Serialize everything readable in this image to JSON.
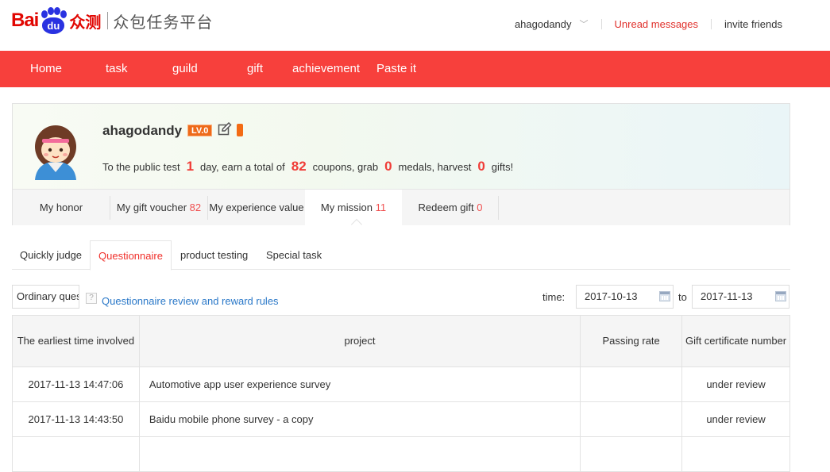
{
  "header": {
    "logo_bai": "Bai",
    "logo_du": "du",
    "logo_zc": "众测",
    "logo_subtitle": "众包任务平台",
    "username": "ahagodandy",
    "unread": "Unread messages",
    "invite": "invite friends"
  },
  "nav": [
    "Home",
    "task",
    "guild",
    "gift",
    "achievement",
    "Paste it"
  ],
  "profile": {
    "name": "ahagodandy",
    "level": "LV.0",
    "stats": {
      "prefix": "To the public test",
      "days": "1",
      "mid1": "day, earn a total of",
      "coupons": "82",
      "mid2": "coupons, grab",
      "medals": "0",
      "mid3": "medals, harvest",
      "gifts": "0",
      "suffix": "gifts!"
    },
    "tabs": [
      {
        "label": "My honor",
        "count": ""
      },
      {
        "label": "My gift voucher",
        "count": "82"
      },
      {
        "label": "My experience value",
        "count": ""
      },
      {
        "label": "My mission",
        "count": "11"
      },
      {
        "label": "Redeem gift",
        "count": "0"
      }
    ]
  },
  "subtabs": [
    "Quickly judge",
    "Questionnaire",
    "product testing",
    "Special task"
  ],
  "filter": {
    "select": "Ordinary questionnaire",
    "help": "?",
    "rules_link": "Questionnaire review and reward rules",
    "time_label": "time:",
    "from": "2017-10-13",
    "to_label": "to",
    "to": "2017-11-13"
  },
  "table": {
    "headers": [
      "The earliest time involved",
      "project",
      "Passing rate",
      "Gift certificate number"
    ],
    "rows": [
      [
        "2017-11-13 14:47:06",
        "Automotive app user experience survey",
        "",
        "under review"
      ],
      [
        "2017-11-13 14:43:50",
        "Baidu mobile phone survey - a copy",
        "",
        "under review"
      ]
    ]
  },
  "colors": {
    "nav_bg": "#f7403c",
    "accent_red": "#f0302b",
    "level_badge": "#ee6a1a",
    "link_blue": "#2a78c8"
  }
}
